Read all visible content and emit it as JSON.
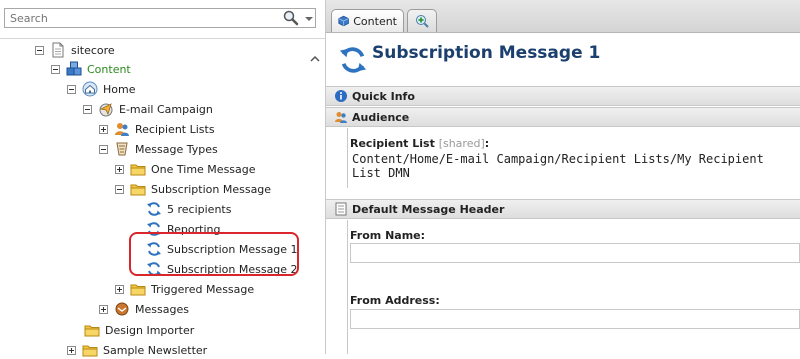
{
  "search": {
    "placeholder": "Search"
  },
  "tree": {
    "sitecore": "sitecore",
    "content": "Content",
    "home": "Home",
    "email_campaign": "E-mail Campaign",
    "recipient_lists": "Recipient Lists",
    "message_types": "Message Types",
    "one_time_message": "One Time Message",
    "subscription_message": "Subscription Message",
    "five_recipients": "5 recipients",
    "reporting": "Reporting",
    "subscription_message_1": "Subscription Message 1",
    "subscription_message_2": "Subscription Message 2",
    "triggered_message": "Triggered Message",
    "messages": "Messages",
    "design_importer": "Design Importer",
    "sample_newsletter": "Sample Newsletter"
  },
  "tabs": {
    "content": "Content"
  },
  "editor": {
    "title": "Subscription Message 1",
    "quick_info": "Quick Info",
    "audience": "Audience",
    "recipient_list_label": "Recipient List",
    "recipient_list_shared": "[shared]",
    "recipient_list_colon": ":",
    "recipient_list_value": "Content/Home/E-mail Campaign/Recipient Lists/My Recipient List DMN",
    "default_message_header": "Default Message Header",
    "from_name_label": "From Name:",
    "from_name_value": "",
    "from_address_label": "From Address:",
    "from_address_value": ""
  },
  "colors": {
    "highlight": "#d9262b",
    "content_green": "#2b8a1c",
    "title_blue": "#1b3f6e"
  }
}
